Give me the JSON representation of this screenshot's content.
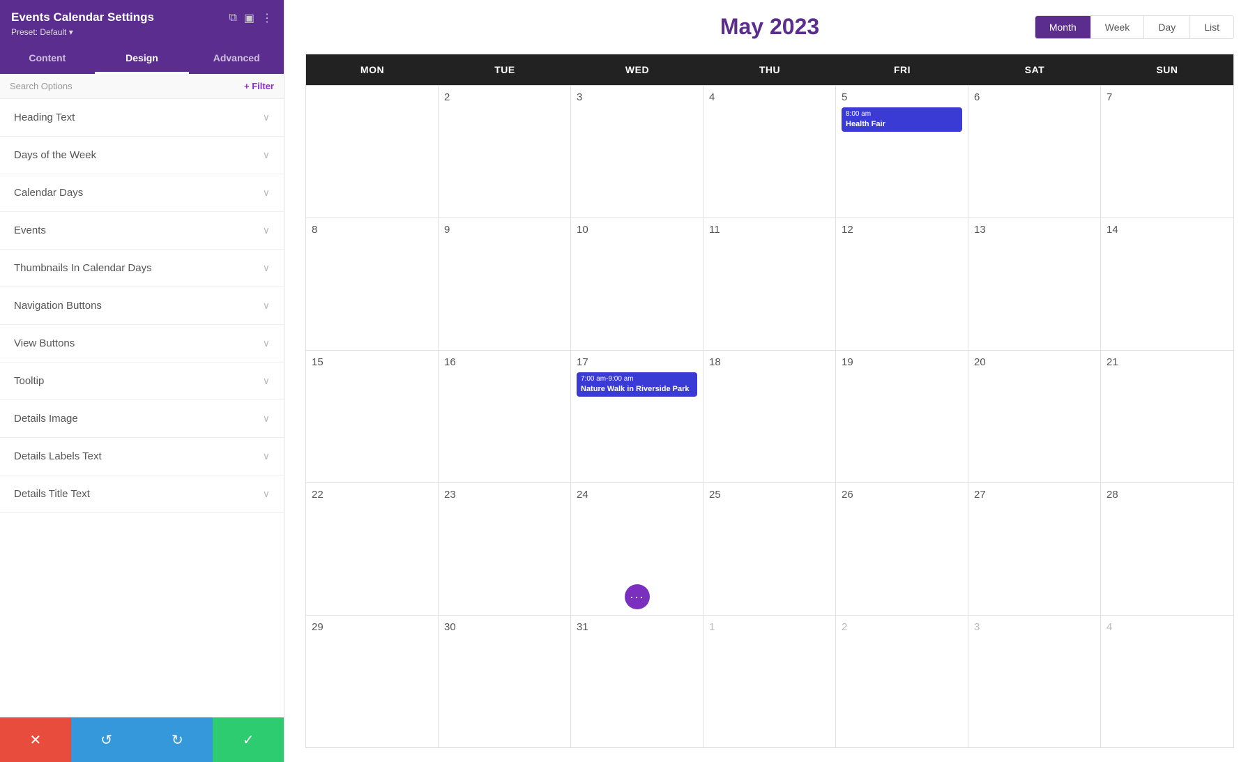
{
  "panel": {
    "title": "Events Calendar Settings",
    "preset_label": "Preset: Default ▾",
    "tabs": [
      {
        "id": "content",
        "label": "Content",
        "active": false
      },
      {
        "id": "design",
        "label": "Design",
        "active": true
      },
      {
        "id": "advanced",
        "label": "Advanced",
        "active": false
      }
    ],
    "search_placeholder": "Search Options",
    "filter_label": "+ Filter",
    "settings_items": [
      {
        "id": "heading-text",
        "label": "Heading Text"
      },
      {
        "id": "days-of-week",
        "label": "Days of the Week"
      },
      {
        "id": "calendar-days",
        "label": "Calendar Days"
      },
      {
        "id": "events",
        "label": "Events"
      },
      {
        "id": "thumbnails",
        "label": "Thumbnails In Calendar Days"
      },
      {
        "id": "navigation-buttons",
        "label": "Navigation Buttons"
      },
      {
        "id": "view-buttons",
        "label": "View Buttons"
      },
      {
        "id": "tooltip",
        "label": "Tooltip"
      },
      {
        "id": "details-image",
        "label": "Details Image"
      },
      {
        "id": "details-labels-text",
        "label": "Details Labels Text"
      },
      {
        "id": "details-title-text",
        "label": "Details Title Text"
      }
    ],
    "bottom_buttons": {
      "cancel": "✕",
      "undo": "↺",
      "redo": "↻",
      "save": "✓"
    }
  },
  "calendar": {
    "title": "May 2023",
    "view_buttons": [
      {
        "id": "month",
        "label": "Month",
        "active": true
      },
      {
        "id": "week",
        "label": "Week",
        "active": false
      },
      {
        "id": "day",
        "label": "Day",
        "active": false
      },
      {
        "id": "list",
        "label": "List",
        "active": false
      }
    ],
    "day_headers": [
      "MON",
      "TUE",
      "WED",
      "THU",
      "FRI",
      "SAT",
      "SUN"
    ],
    "weeks": [
      {
        "days": [
          {
            "num": "",
            "muted": false,
            "event": null
          },
          {
            "num": "2",
            "muted": false,
            "event": null
          },
          {
            "num": "3",
            "muted": false,
            "event": null
          },
          {
            "num": "4",
            "muted": false,
            "event": null
          },
          {
            "num": "5",
            "muted": false,
            "event": {
              "time": "8:00 am",
              "title": "Health Fair",
              "color": "blue"
            }
          },
          {
            "num": "6",
            "muted": false,
            "event": null
          },
          {
            "num": "7",
            "muted": false,
            "event": null
          }
        ]
      },
      {
        "days": [
          {
            "num": "8",
            "muted": false,
            "event": null
          },
          {
            "num": "9",
            "muted": false,
            "event": null
          },
          {
            "num": "10",
            "muted": false,
            "event": null
          },
          {
            "num": "11",
            "muted": false,
            "event": null
          },
          {
            "num": "12",
            "muted": false,
            "event": null
          },
          {
            "num": "13",
            "muted": false,
            "event": null
          },
          {
            "num": "14",
            "muted": false,
            "event": null
          }
        ]
      },
      {
        "days": [
          {
            "num": "15",
            "muted": false,
            "event": null
          },
          {
            "num": "16",
            "muted": false,
            "event": null
          },
          {
            "num": "17",
            "muted": false,
            "event": {
              "time": "7:00 am-9:00 am",
              "title": "Nature Walk in Riverside Park",
              "color": "blue"
            }
          },
          {
            "num": "18",
            "muted": false,
            "event": null
          },
          {
            "num": "19",
            "muted": false,
            "event": null
          },
          {
            "num": "20",
            "muted": false,
            "event": null
          },
          {
            "num": "21",
            "muted": false,
            "event": null
          }
        ]
      },
      {
        "days": [
          {
            "num": "22",
            "muted": false,
            "event": null,
            "has_dots": false
          },
          {
            "num": "23",
            "muted": false,
            "event": null
          },
          {
            "num": "24",
            "muted": false,
            "event": null,
            "has_dots": true
          },
          {
            "num": "25",
            "muted": false,
            "event": null
          },
          {
            "num": "26",
            "muted": false,
            "event": null
          },
          {
            "num": "27",
            "muted": false,
            "event": null
          },
          {
            "num": "28",
            "muted": false,
            "event": null
          }
        ]
      },
      {
        "days": [
          {
            "num": "29",
            "muted": false,
            "event": null
          },
          {
            "num": "30",
            "muted": false,
            "event": null
          },
          {
            "num": "31",
            "muted": false,
            "event": null
          },
          {
            "num": "1",
            "muted": true,
            "event": null
          },
          {
            "num": "2",
            "muted": true,
            "event": null
          },
          {
            "num": "3",
            "muted": true,
            "event": null
          },
          {
            "num": "4",
            "muted": true,
            "event": null
          }
        ]
      }
    ]
  }
}
